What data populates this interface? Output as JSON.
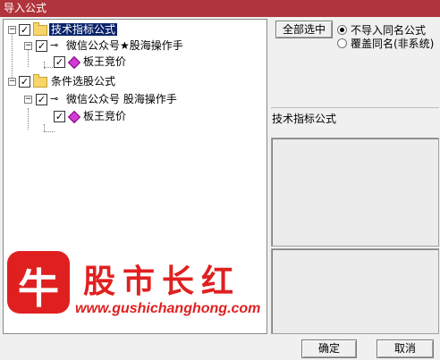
{
  "window": {
    "title": "导入公式"
  },
  "tree": {
    "nodes": [
      {
        "label": "技术指标公式",
        "checked": true,
        "selected": true,
        "icon": "folder-icon"
      },
      {
        "label": "微信公众号★股海操作手",
        "checked": true,
        "icon": "key-icon"
      },
      {
        "label": "板王竞价",
        "checked": true,
        "icon": "diamond-icon"
      },
      {
        "label": "条件选股公式",
        "checked": true,
        "icon": "folder-icon"
      },
      {
        "label": "微信公众号 股海操作手",
        "checked": true,
        "icon": "key-icon"
      },
      {
        "label": "板王竞价",
        "checked": true,
        "icon": "diamond-icon"
      }
    ],
    "expander_symbol": "−",
    "check_symbol": "✓"
  },
  "options": {
    "select_all_label": "全部选中",
    "radio_no_import": "不导入同名公式",
    "radio_overwrite": "覆盖同名(非系统)",
    "selected_radio": "radio_no_import"
  },
  "detail": {
    "heading": "技术指标公式"
  },
  "buttons": {
    "ok": "确定",
    "cancel": "取消"
  },
  "watermark": {
    "logo_char": "牛",
    "title": "股市长红",
    "url": "www.gushichanghong.com"
  },
  "colors": {
    "titlebar": "#b0343b",
    "selection": "#0a246a",
    "watermark": "#e02020"
  }
}
